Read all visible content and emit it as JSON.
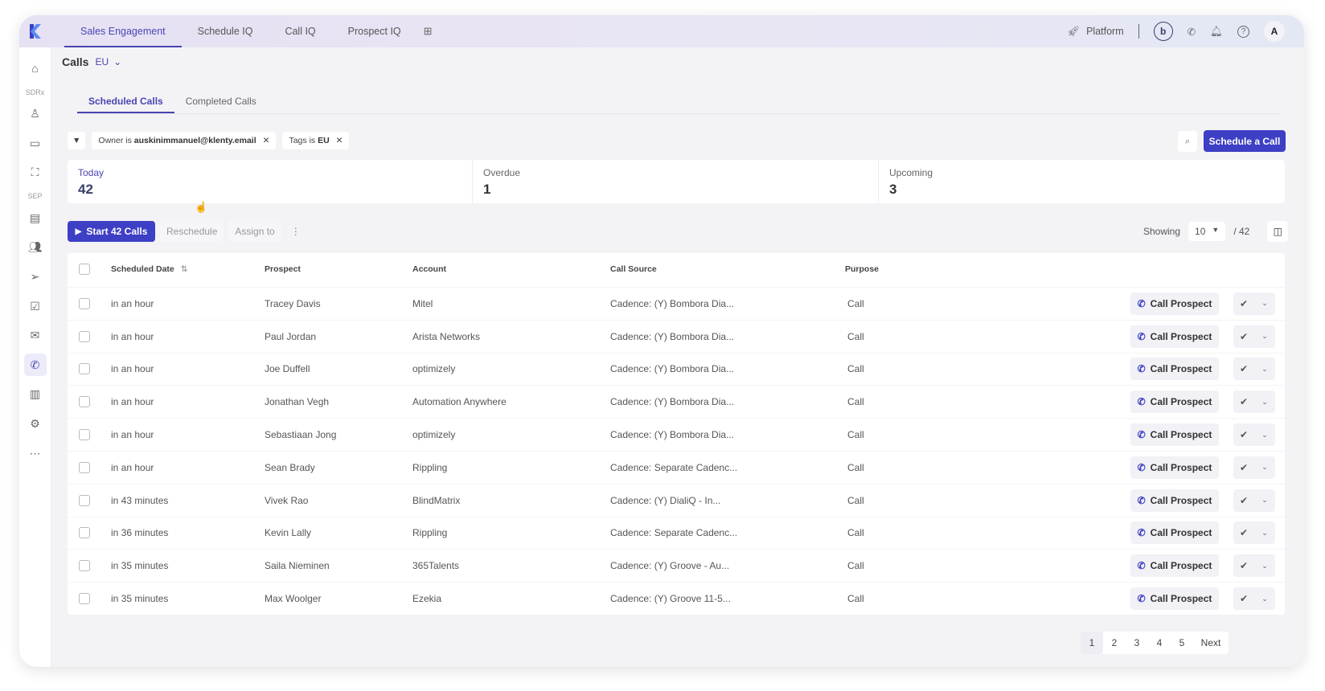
{
  "nav": {
    "tabs": [
      "Sales Engagement",
      "Schedule IQ",
      "Call IQ",
      "Prospect IQ"
    ],
    "platform": "Platform",
    "avatar": "A"
  },
  "sidebar": {
    "section1": "SDRx",
    "section2": "SEP"
  },
  "page": {
    "title": "Calls",
    "region": "EU"
  },
  "subtabs": [
    "Scheduled Calls",
    "Completed Calls"
  ],
  "filters": [
    {
      "key": "Owner",
      "op": "is",
      "value": "auskinimmanuel@klenty.email"
    },
    {
      "key": "Tags",
      "op": "is",
      "value": "EU"
    }
  ],
  "schedule_btn": "Schedule a Call",
  "stats": [
    {
      "label": "Today",
      "value": "42"
    },
    {
      "label": "Overdue",
      "value": "1"
    },
    {
      "label": "Upcoming",
      "value": "3"
    }
  ],
  "actions": {
    "start": "Start 42 Calls",
    "reschedule": "Reschedule",
    "assign": "Assign to",
    "showing": "Showing",
    "per_page": "10",
    "total": "/ 42"
  },
  "columns": [
    "Scheduled Date",
    "Prospect",
    "Account",
    "Call Source",
    "Purpose"
  ],
  "row_button": "Call Prospect",
  "rows": [
    {
      "date": "in an hour",
      "prospect": "Tracey Davis",
      "account": "Mitel",
      "source": "Cadence: (Y) Bombora Dia...",
      "purpose": "Call"
    },
    {
      "date": "in an hour",
      "prospect": "Paul Jordan",
      "account": "Arista Networks",
      "source": "Cadence: (Y) Bombora Dia...",
      "purpose": "Call"
    },
    {
      "date": "in an hour",
      "prospect": "Joe Duffell",
      "account": "optimizely",
      "source": "Cadence: (Y) Bombora Dia...",
      "purpose": "Call"
    },
    {
      "date": "in an hour",
      "prospect": "Jonathan Vegh",
      "account": "Automation Anywhere",
      "source": "Cadence: (Y) Bombora Dia...",
      "purpose": "Call"
    },
    {
      "date": "in an hour",
      "prospect": "Sebastiaan Jong",
      "account": "optimizely",
      "source": "Cadence: (Y) Bombora Dia...",
      "purpose": "Call"
    },
    {
      "date": "in an hour",
      "prospect": "Sean Brady",
      "account": "Rippling",
      "source": "Cadence: Separate Cadenc...",
      "purpose": "Call"
    },
    {
      "date": "in 43 minutes",
      "prospect": "Vivek Rao",
      "account": "BlindMatrix",
      "source": "Cadence: (Y) DialiQ - In...",
      "purpose": "Call"
    },
    {
      "date": "in 36 minutes",
      "prospect": "Kevin Lally",
      "account": "Rippling",
      "source": "Cadence: Separate Cadenc...",
      "purpose": "Call"
    },
    {
      "date": "in 35 minutes",
      "prospect": "Saila Nieminen",
      "account": "365Talents",
      "source": "Cadence: (Y) Groove - Au...",
      "purpose": "Call"
    },
    {
      "date": "in 35 minutes",
      "prospect": "Max Woolger",
      "account": "Ezekia",
      "source": "Cadence: (Y) Groove 11-5...",
      "purpose": "Call"
    }
  ],
  "pagination": {
    "pages": [
      "1",
      "2",
      "3",
      "4",
      "5"
    ],
    "next": "Next"
  },
  "colors": {
    "accent": "#3d3fc4",
    "active_text": "#4a45b0"
  }
}
